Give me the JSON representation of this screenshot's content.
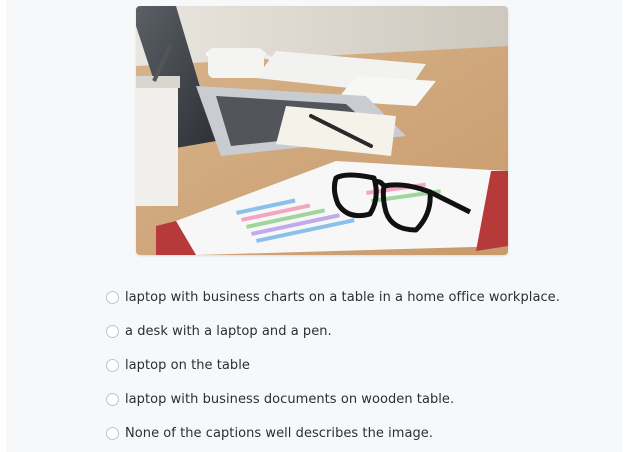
{
  "image": {
    "alt": ""
  },
  "options": [
    {
      "label": "laptop with business charts on a table in a home office workplace."
    },
    {
      "label": "a desk with a laptop and a pen."
    },
    {
      "label": "laptop on the table"
    },
    {
      "label": "laptop with business documents on wooden table."
    },
    {
      "label": "None of the captions well describes the image."
    }
  ],
  "colors": {
    "background": "#f7f8fa",
    "text": "#2b2f36",
    "radio_border": "#bfc4cc"
  }
}
